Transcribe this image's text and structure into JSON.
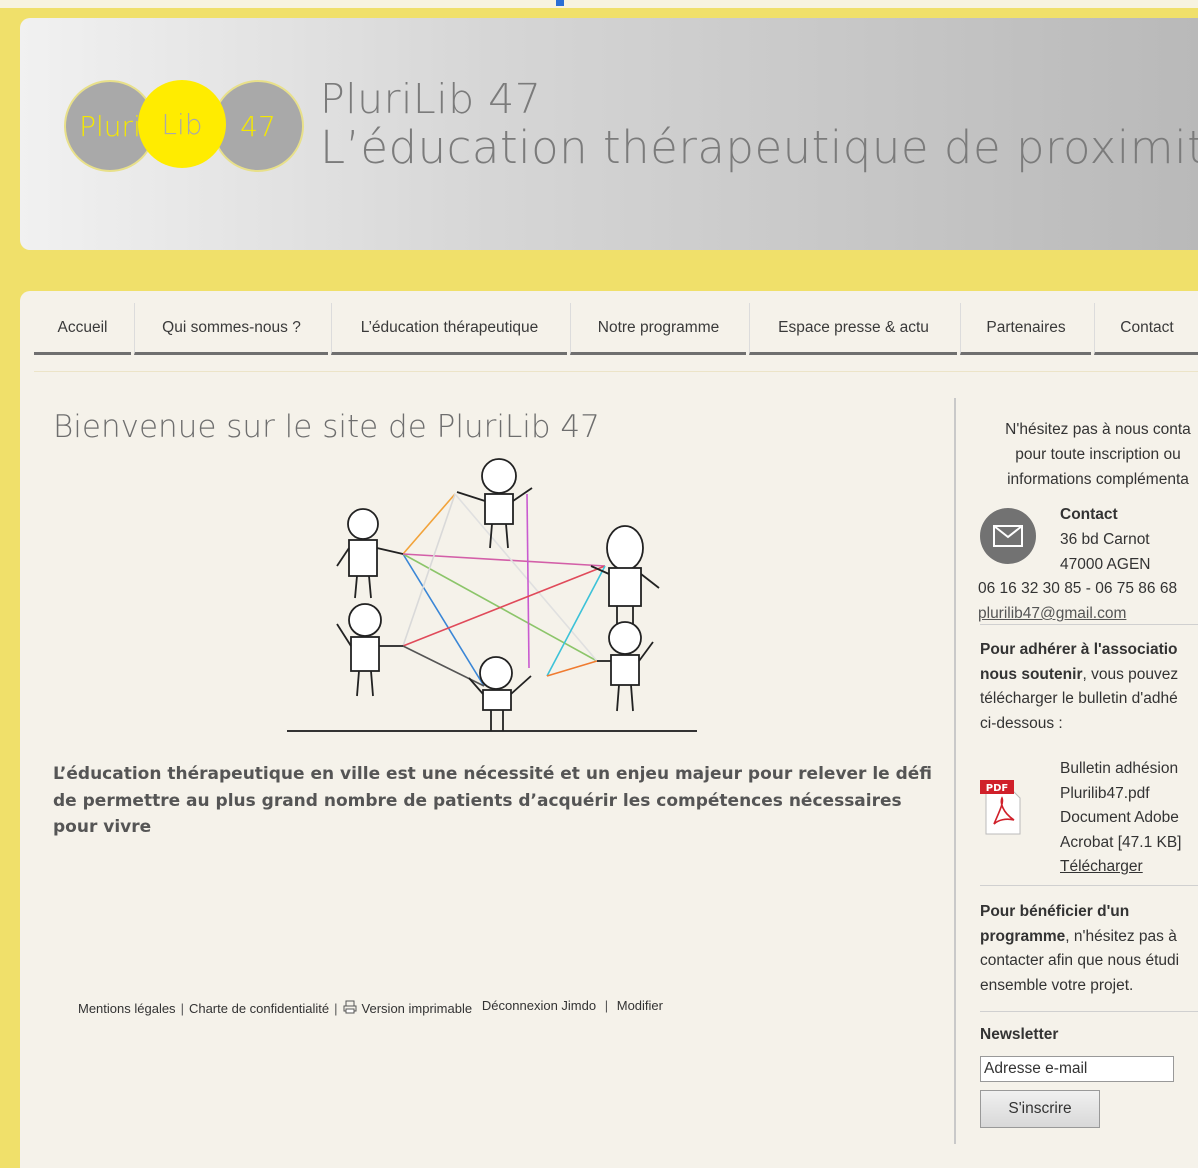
{
  "site": {
    "logo": {
      "part1": "Pluri",
      "part2": "Lib",
      "part3": "47"
    },
    "title_line1": "PluriLib 47",
    "title_line2": "L’éducation thérapeutique de proximité"
  },
  "nav": {
    "items": [
      {
        "label": "Accueil"
      },
      {
        "label": "Qui sommes-nous ?"
      },
      {
        "label": "L’éducation thérapeutique"
      },
      {
        "label": "Notre programme"
      },
      {
        "label": "Espace presse & actu"
      },
      {
        "label": "Partenaires"
      },
      {
        "label": "Contact"
      }
    ]
  },
  "main": {
    "title": "Bienvenue sur le site de PluriLib 47",
    "lead": "L’éducation thérapeutique en ville est une nécessité et un enjeu majeur pour relever le défi de permettre au plus grand nombre de patients d’acquérir les compétences nécessaires pour vivre"
  },
  "footer": {
    "mentions": "Mentions légales",
    "charte": "Charte de confidentialité",
    "print": "Version imprimable",
    "logout": "Déconnexion Jimdo",
    "edit": "Modifier"
  },
  "sidebar": {
    "intro_line1": "N'hésitez pas à nous conta",
    "intro_line2": "pour toute inscription ou",
    "intro_line3": "informations complémenta",
    "contact_title": "Contact",
    "address1": "36 bd Carnot",
    "address2": "47000 AGEN",
    "phones": "06 16 32 30 85 - 06 75 86 68",
    "email": "plurilib47@gmail.com",
    "join_bold1": "Pour adhérer à l'associatio",
    "join_bold2": "nous soutenir",
    "join_rest2": ", vous pouvez",
    "join_line3": "télécharger le bulletin d'adhé",
    "join_line4": "ci-dessous :",
    "pdf_badge": "PDF",
    "file_line1": "Bulletin adhésion",
    "file_line2": "Plurilib47.pdf",
    "file_line3": "Document Adobe",
    "file_line4": "Acrobat [47.1 KB]",
    "download": "Télécharger",
    "program_bold1": "Pour bénéficier d'un",
    "program_bold2": "programme",
    "program_rest2": ", n'hésitez pas à",
    "program_line3": "contacter afin que nous étudi",
    "program_line4": "ensemble votre projet.",
    "newsletter_title": "Newsletter",
    "newsletter_placeholder": "Adresse e-mail",
    "newsletter_button": "S'inscrire"
  },
  "colors": {
    "background": "#f0e06a",
    "logo_yellow": "#ffec00",
    "logo_grey": "#a9a9a9",
    "panel": "#f5f2ea",
    "nav_underline": "#6f6f6f"
  }
}
